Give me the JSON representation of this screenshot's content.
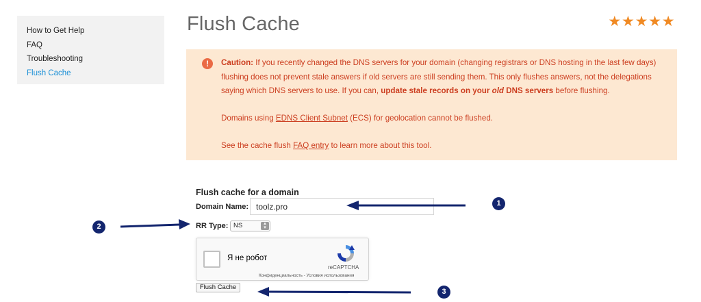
{
  "sidebar": {
    "items": [
      {
        "label": "How to Get Help"
      },
      {
        "label": "FAQ"
      },
      {
        "label": "Troubleshooting"
      },
      {
        "label": "Flush Cache",
        "active": true
      }
    ]
  },
  "page": {
    "title": "Flush Cache",
    "rating_stars": 5,
    "star_color": "#f08a24"
  },
  "caution": {
    "icon_text": "!",
    "label": "Caution:",
    "text_1": " If you recently changed the DNS servers for your domain (changing registrars or DNS hosting in the last few days) flushing does not prevent stale answers if old servers are still sending them. This only flushes answers, not the delegations saying which DNS servers to use. If you can, ",
    "bold_1": "update stale records on your ",
    "bold_italic": "old",
    "bold_2": " DNS servers",
    "text_2": " before flushing.",
    "ecs_prefix": "Domains using ",
    "ecs_link": "EDNS Client Subnet",
    "ecs_suffix": " (ECS) for geolocation cannot be flushed.",
    "faq_prefix": "See the cache flush ",
    "faq_link": "FAQ entry",
    "faq_suffix": " to learn more about this tool.",
    "bg_color": "#fde8d2",
    "text_color": "#cc3e20"
  },
  "form": {
    "title": "Flush cache for a domain",
    "domain_label": "Domain Name:",
    "domain_value": "toolz.pro",
    "rr_label": "RR Type:",
    "rr_value": "NS",
    "submit_label": "Flush Cache"
  },
  "recaptcha": {
    "checkbox_label": "Я не робот",
    "brand": "reCAPTCHA",
    "terms": "Конфиденциальность - Условия использования"
  },
  "annotations": {
    "badges": [
      "1",
      "2",
      "3"
    ],
    "arrow_color": "#13256e"
  }
}
